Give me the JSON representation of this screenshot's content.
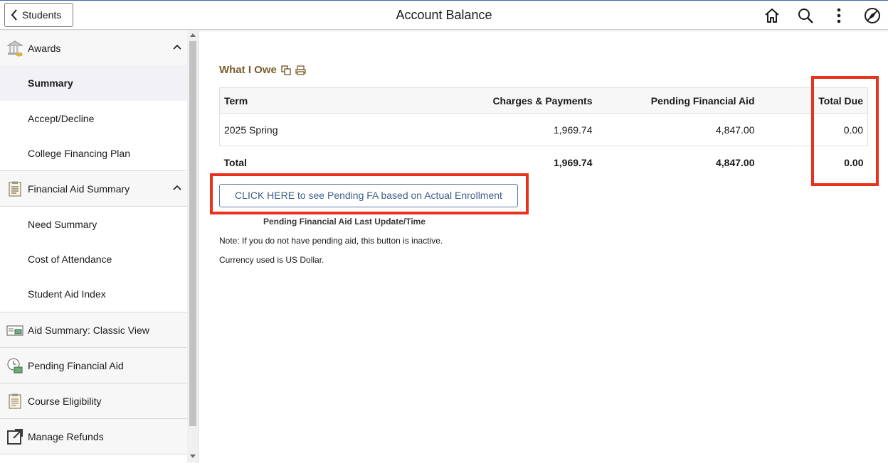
{
  "header": {
    "back_label": "Students",
    "title": "Account Balance"
  },
  "sidebar": {
    "awards": {
      "label": "Awards",
      "items": [
        "Summary",
        "Accept/Decline",
        "College Financing Plan"
      ]
    },
    "fa_summary": {
      "label": "Financial Aid Summary",
      "items": [
        "Need Summary",
        "Cost of Attendance",
        "Student Aid Index"
      ]
    },
    "links": [
      {
        "label": "Aid Summary: Classic View",
        "icon": "classic-view-icon"
      },
      {
        "label": "Pending Financial Aid",
        "icon": "pending-aid-icon"
      },
      {
        "label": "Course Eligibility",
        "icon": "clipboard-icon"
      },
      {
        "label": "Manage Refunds",
        "icon": "external-link-icon"
      }
    ]
  },
  "main": {
    "title": "What I Owe",
    "table": {
      "headers": [
        "Term",
        "Charges & Payments",
        "Pending Financial Aid",
        "Total Due"
      ],
      "rows": [
        [
          "2025 Spring",
          "1,969.74",
          "4,847.00",
          "0.00"
        ]
      ],
      "total": [
        "Total",
        "1,969.74",
        "4,847.00",
        "0.00"
      ]
    },
    "pending_button": "CLICK HERE to see Pending FA based on Actual Enrollment",
    "last_update_label": "Pending Financial Aid Last Update/Time",
    "note": "Note: If you do not have pending aid, this button is inactive.",
    "currency": "Currency used is US Dollar."
  },
  "colors": {
    "accent_brown": "#7b5b2b",
    "button_blue": "#3f5f8a",
    "highlight_red": "#e8321e"
  }
}
